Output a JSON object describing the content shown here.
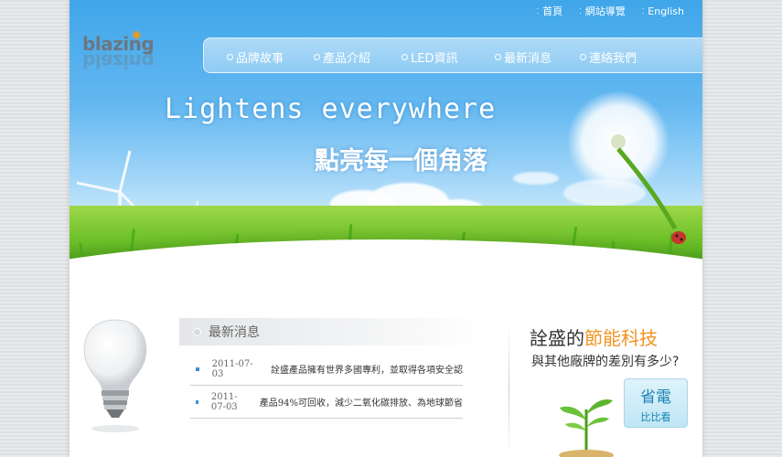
{
  "header": {
    "logo_text": "blazing",
    "top_links": [
      {
        "label": "首頁"
      },
      {
        "label": "網站導覽"
      },
      {
        "label": "English"
      }
    ]
  },
  "nav": {
    "items": [
      {
        "label": "品牌故事"
      },
      {
        "label": "產品介紹"
      },
      {
        "label": "LED資訊"
      },
      {
        "label": "最新消息"
      },
      {
        "label": "連絡我們"
      }
    ]
  },
  "hero": {
    "tagline_en": "Lightens  everywhere",
    "tagline_zh": "點亮每一個角落"
  },
  "news": {
    "heading": "最新消息",
    "items": [
      {
        "date": "2011-07-03",
        "text": "詮盛產品擁有世界多國專利，並取得各項安全認"
      },
      {
        "date": "2011-07-03",
        "text": "產品94%可回收，減少二氧化碳排放、為地球節省"
      }
    ]
  },
  "promo": {
    "title_prefix": "詮盛的",
    "title_highlight": "節能科技",
    "subtitle": "與其他廠牌的差別有多少?",
    "button_big": "省電",
    "button_small": "比比看"
  },
  "colors": {
    "accent_orange": "#f19322",
    "button_blue": "#1b84b4",
    "news_bullet": "#3b8fd3"
  }
}
